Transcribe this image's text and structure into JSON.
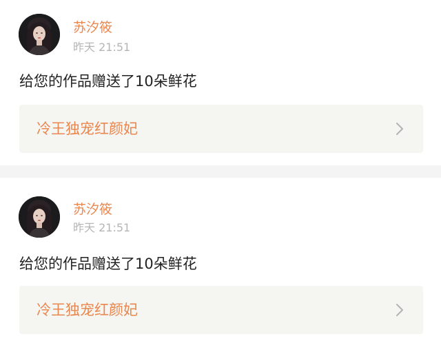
{
  "feed": {
    "items": [
      {
        "username": "苏汐筱",
        "time": "昨天 21:51",
        "message": "给您的作品赠送了10朵鲜花",
        "work_title": "冷王独宠红颜妃",
        "avatar_icon": "user-avatar-photo",
        "chevron_icon": "chevron-right-icon"
      },
      {
        "username": "苏汐筱",
        "time": "昨天 21:51",
        "message": "给您的作品赠送了10朵鲜花",
        "work_title": "冷王独宠红颜妃",
        "avatar_icon": "user-avatar-photo",
        "chevron_icon": "chevron-right-icon"
      }
    ]
  },
  "colors": {
    "accent": "#e9874f",
    "muted": "#b5b5b5",
    "text": "#222222",
    "link_bg": "#f5f5f2",
    "separator": "#f4f4f4"
  }
}
